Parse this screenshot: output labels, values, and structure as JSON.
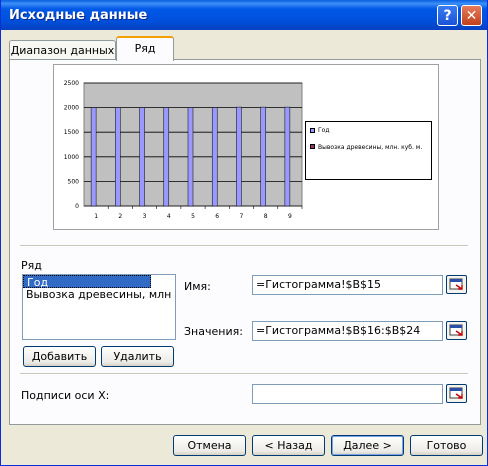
{
  "window": {
    "title": "Исходные данные"
  },
  "tabs": [
    {
      "label": "Диапазон данных"
    },
    {
      "label": "Ряд"
    }
  ],
  "chart_data": {
    "type": "bar",
    "categories": [
      "1",
      "2",
      "3",
      "4",
      "5",
      "6",
      "7",
      "8",
      "9"
    ],
    "series": [
      {
        "name": "Год",
        "values": [
          2000,
          2000,
          2000,
          2000,
          2000,
          2000,
          2010,
          2010,
          2010
        ],
        "color": "#9999ff"
      },
      {
        "name": "Вывозка древесины, млн. куб. м.",
        "values": [
          0,
          0,
          0,
          0,
          0,
          0,
          0,
          0,
          0
        ],
        "color": "#993366"
      }
    ],
    "yticks": [
      "2500",
      "2000",
      "1500",
      "1000",
      "500",
      "0"
    ],
    "ylim": [
      0,
      2500
    ],
    "plot_background": "#c0c0c0",
    "legend": {
      "items": [
        "Год",
        "Вывозка древесины, млн. куб. м."
      ],
      "position": "right"
    }
  },
  "series_panel": {
    "label": "Ряд",
    "items": [
      "Год",
      "Вывозка древесины, млн"
    ],
    "selected": 0,
    "add_button": "Добавить",
    "delete_button": "Удалить"
  },
  "fields": {
    "name_label": "Имя:",
    "name_value": "=Гистограмма!$B$15",
    "values_label": "Значения:",
    "values_value": "=Гистограмма!$B$16:$B$24",
    "xlabels_label": "Подписи оси X:",
    "xlabels_value": ""
  },
  "buttons": {
    "cancel": "Отмена",
    "back": "< Назад",
    "next": "Далее >",
    "finish": "Готово"
  }
}
